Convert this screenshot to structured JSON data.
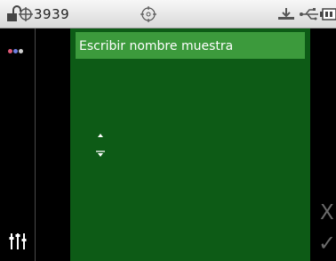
{
  "status_bar": {
    "sample_count": "3939",
    "icons": [
      "unlock-icon",
      "crosshair-icon",
      "target-icon",
      "download-tray-icon",
      "usb-icon",
      "battery-icon"
    ]
  },
  "left_toolbar": {
    "dots_colors": [
      "#e05a78",
      "#6e7fe0",
      "#d0d0d0"
    ],
    "icons": [
      "color-dots-icon",
      "sliders-icon"
    ]
  },
  "sample_name": {
    "label": "Escribir nombre muestra"
  },
  "right_toolbar": {
    "cancel_label": "X",
    "ok_label": "✓"
  },
  "colors": {
    "field_background": "#3c9a3c",
    "panel_background": "#0d5b16",
    "status_bar_background": "#e6e6e6"
  }
}
